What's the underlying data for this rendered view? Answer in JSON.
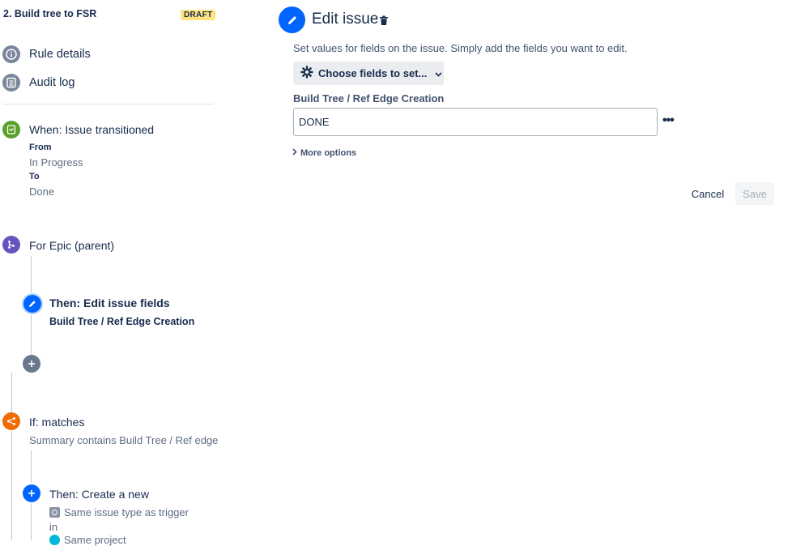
{
  "rule": {
    "title": "2. Build tree to FSR",
    "status_badge": "DRAFT"
  },
  "nav": [
    {
      "label": "Rule details",
      "icon": "info-icon"
    },
    {
      "label": "Audit log",
      "icon": "list-icon"
    }
  ],
  "trigger": {
    "title": "When: Issue transitioned",
    "from_label": "From",
    "from_value": "In Progress",
    "to_label": "To",
    "to_value": "Done"
  },
  "branch": {
    "title": "For Epic (parent)"
  },
  "branch_action": {
    "title": "Then: Edit issue fields",
    "subtitle": "Build Tree / Ref Edge Creation"
  },
  "condition": {
    "title": "If: matches",
    "subtitle": "Summary contains Build Tree / Ref edge"
  },
  "create_action": {
    "title": "Then: Create a new",
    "line1": "Same issue type as trigger",
    "line2": "in",
    "line3": "Same project"
  },
  "editor": {
    "title": "Edit issue",
    "description": "Set values for fields on the issue. Simply add the fields you want to edit.",
    "choose_fields_label": "Choose fields to set...",
    "field_label": "Build Tree / Ref Edge Creation",
    "field_value": "DONE",
    "more_options_label": "More options",
    "cancel_label": "Cancel",
    "save_label": "Save"
  },
  "colors": {
    "trigger": "#5aa02c",
    "branch": "#6554c0",
    "action": "#0065ff",
    "condition": "#ef6c00",
    "nav_icon": "#7a869a",
    "badge": "#ffe380"
  }
}
